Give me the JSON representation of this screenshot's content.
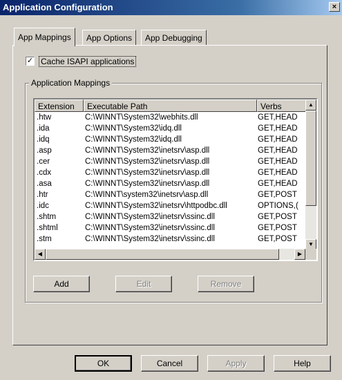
{
  "window": {
    "title": "Application Configuration",
    "close_glyph": "×"
  },
  "tabs": [
    {
      "label": "App Mappings",
      "active": true
    },
    {
      "label": "App Options",
      "active": false
    },
    {
      "label": "App Debugging",
      "active": false
    }
  ],
  "cache_isapi": {
    "label": "Cache ISAPI applications",
    "checked": true,
    "check_glyph": "✓"
  },
  "mappings_group": {
    "title": "Application Mappings"
  },
  "table": {
    "columns": [
      "Extension",
      "Executable Path",
      "Verbs"
    ],
    "rows": [
      [
        ".htw",
        "C:\\WINNT\\System32\\webhits.dll",
        "GET,HEAD"
      ],
      [
        ".ida",
        "C:\\WINNT\\System32\\idq.dll",
        "GET,HEAD"
      ],
      [
        ".idq",
        "C:\\WINNT\\System32\\idq.dll",
        "GET,HEAD"
      ],
      [
        ".asp",
        "C:\\WINNT\\System32\\inetsrv\\asp.dll",
        "GET,HEAD"
      ],
      [
        ".cer",
        "C:\\WINNT\\System32\\inetsrv\\asp.dll",
        "GET,HEAD"
      ],
      [
        ".cdx",
        "C:\\WINNT\\System32\\inetsrv\\asp.dll",
        "GET,HEAD"
      ],
      [
        ".asa",
        "C:\\WINNT\\System32\\inetsrv\\asp.dll",
        "GET,HEAD"
      ],
      [
        ".htr",
        "C:\\WINNT\\system32\\inetsrv\\asp.dll",
        "GET,POST"
      ],
      [
        ".idc",
        "C:\\WINNT\\System32\\inetsrv\\httpodbc.dll",
        "OPTIONS,("
      ],
      [
        ".shtm",
        "C:\\WINNT\\System32\\inetsrv\\ssinc.dll",
        "GET,POST"
      ],
      [
        ".shtml",
        "C:\\WINNT\\System32\\inetsrv\\ssinc.dll",
        "GET,POST"
      ],
      [
        ".stm",
        "C:\\WINNT\\System32\\inetsrv\\ssinc.dll",
        "GET,POST"
      ]
    ]
  },
  "scroll": {
    "up": "▲",
    "down": "▼",
    "left": "◀",
    "right": "▶"
  },
  "group_buttons": {
    "add": "Add",
    "edit": "Edit",
    "remove": "Remove"
  },
  "footer_buttons": {
    "ok": "OK",
    "cancel": "Cancel",
    "apply": "Apply",
    "help": "Help"
  }
}
